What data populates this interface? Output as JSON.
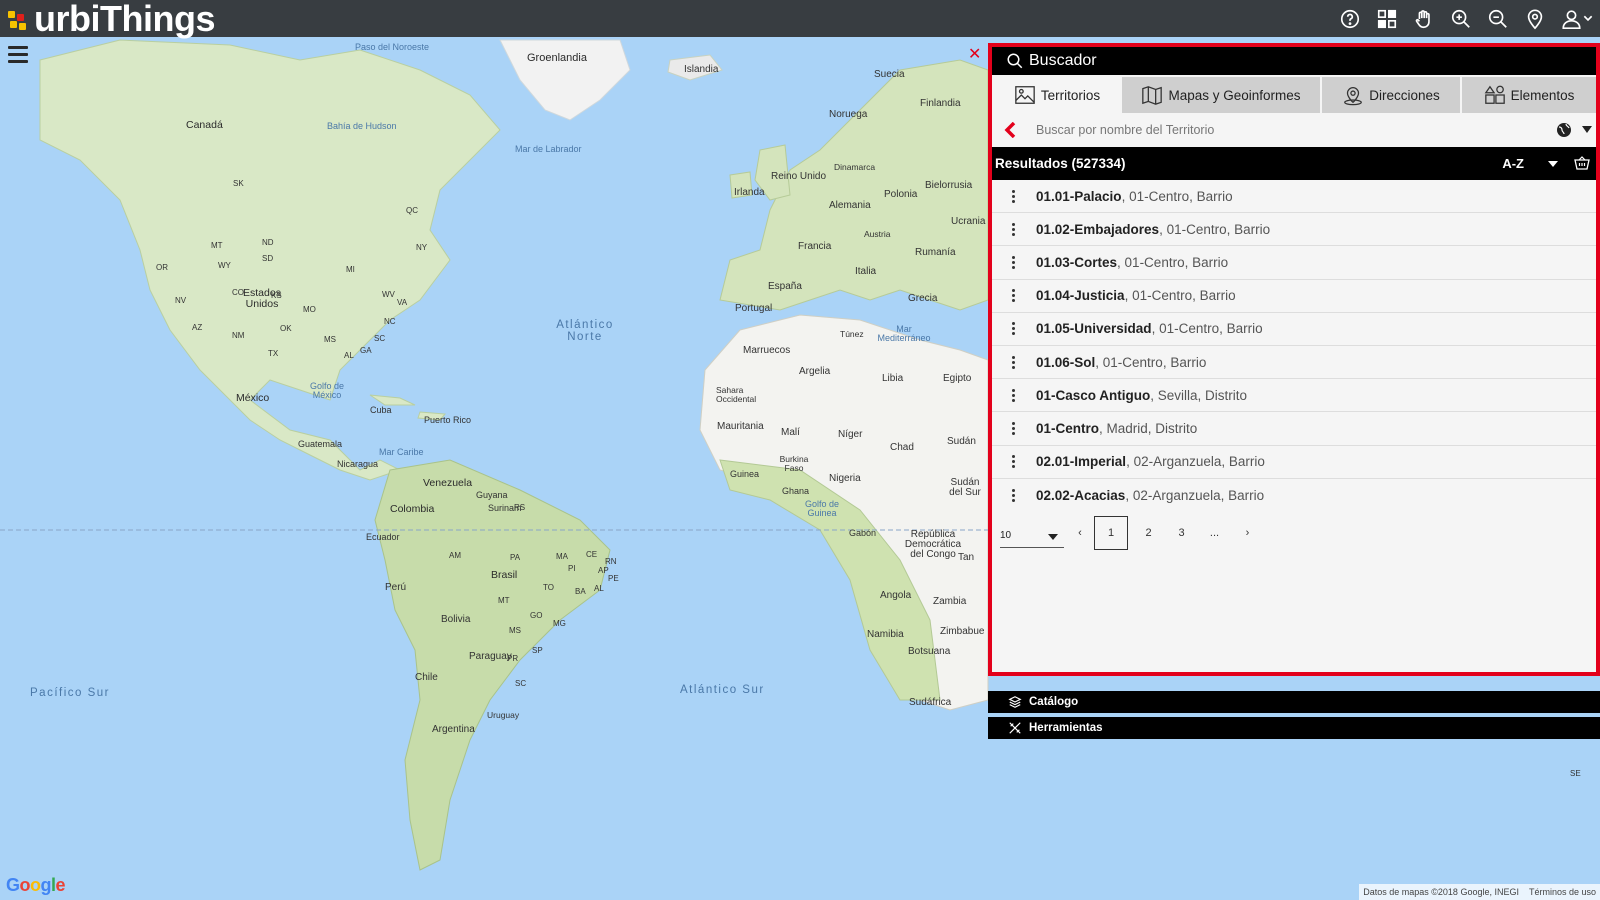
{
  "brand": {
    "name": "urbiThings"
  },
  "topbar": {
    "icons": [
      "help-icon",
      "layers-grid-icon",
      "pan-hand-icon",
      "zoom-in-icon",
      "zoom-out-icon",
      "location-pin-icon",
      "user-icon"
    ]
  },
  "colors": {
    "panel_border": "#e3001b",
    "header_bg": "#000000",
    "topbar_bg": "#282828"
  },
  "panel": {
    "title": "Buscador",
    "tabs": [
      {
        "label": "Territorios",
        "icon": "image-icon",
        "active": true
      },
      {
        "label": "Mapas y Geoinformes",
        "icon": "map-icon",
        "active": false
      },
      {
        "label": "Direcciones",
        "icon": "address-pin-icon",
        "active": false
      },
      {
        "label": "Elementos",
        "icon": "elements-icon",
        "active": false
      }
    ],
    "search": {
      "placeholder": "Buscar por nombre del Territorio"
    },
    "results": {
      "title": "Resultados (527334)",
      "sort": "A-Z",
      "items": [
        {
          "name": "01.01-Palacio",
          "meta": ", 01-Centro, Barrio"
        },
        {
          "name": "01.02-Embajadores",
          "meta": ", 01-Centro, Barrio"
        },
        {
          "name": "01.03-Cortes",
          "meta": ", 01-Centro, Barrio"
        },
        {
          "name": "01.04-Justicia",
          "meta": ", 01-Centro, Barrio"
        },
        {
          "name": "01.05-Universidad",
          "meta": ", 01-Centro, Barrio"
        },
        {
          "name": "01.06-Sol",
          "meta": ", 01-Centro, Barrio"
        },
        {
          "name": "01-Casco Antiguo",
          "meta": ", Sevilla, Distrito"
        },
        {
          "name": "01-Centro",
          "meta": ", Madrid, Distrito"
        },
        {
          "name": "02.01-Imperial",
          "meta": ", 02-Arganzuela, Barrio"
        },
        {
          "name": "02.02-Acacias",
          "meta": ", 02-Arganzuela, Barrio"
        }
      ]
    },
    "pager": {
      "page_size": "10",
      "prev": "‹",
      "pages": [
        "1",
        "2",
        "3"
      ],
      "ellipsis": "...",
      "next": "›",
      "current": "1"
    }
  },
  "sections": {
    "catalog": "Catálogo",
    "tools": "Herramientas"
  },
  "map": {
    "labels": [
      "Paso del Noroeste",
      "Groenlandia",
      "Islandia",
      "Suecia",
      "Finlandia",
      "Canadá",
      "Bahía de Hudson",
      "Mar de Labrador",
      "Noruega",
      "Reino Unido",
      "Dinamarca",
      "Bielorrusia",
      "Irlanda",
      "Polonia",
      "Alemania",
      "Ucrania",
      "Austria",
      "Francia",
      "Rumanía",
      "Italia",
      "España",
      "Portugal",
      "Grecia",
      "Estados Unidos",
      "Atlántico Norte",
      "Túnez",
      "Mar Mediterráneo",
      "Marruecos",
      "Argelia",
      "Libia",
      "Egipto",
      "Sahara Occidental",
      "México",
      "Golfo de México",
      "Cuba",
      "Puerto Rico",
      "Mauritania",
      "Malí",
      "Níger",
      "Chad",
      "Sudán",
      "Guatemala",
      "Mar Caribe",
      "Nicaragua",
      "Burkina Faso",
      "Guinea",
      "Nigeria",
      "Ghana",
      "Venezuela",
      "Guyana",
      "Surinam",
      "Golfo de Guinea",
      "Sudán del Sur",
      "Colombia",
      "Ecuador",
      "Gabón",
      "República Democrática del Congo",
      "Brasil",
      "Perú",
      "Angola",
      "Zambia",
      "Bolivia",
      "Paraguay",
      "Namibia",
      "Zimbabue",
      "Botsuana",
      "Pacífico Sur",
      "Chile",
      "Atlántico Sur",
      "Sudáfrica",
      "Argentina",
      "Uruguay",
      "Tan",
      "SK",
      "QC",
      "ND",
      "MT",
      "OR",
      "WY",
      "SD",
      "NV",
      "CO",
      "KS",
      "MO",
      "AZ",
      "NM",
      "OK",
      "TX",
      "MS",
      "MI",
      "NY",
      "WV",
      "VA",
      "NC",
      "SC",
      "GA",
      "AL",
      "AM",
      "PA",
      "MA",
      "CE",
      "RN",
      "PI",
      "TO",
      "BA",
      "MT",
      "GO",
      "MG",
      "MS",
      "SP",
      "PR",
      "SC",
      "RS",
      "AP",
      "PE",
      "AL",
      "SE",
      "TAS"
    ],
    "google_logo": "Google",
    "attribution": [
      "Datos de mapas ©2018 Google, INEGI",
      "Términos de uso"
    ]
  }
}
